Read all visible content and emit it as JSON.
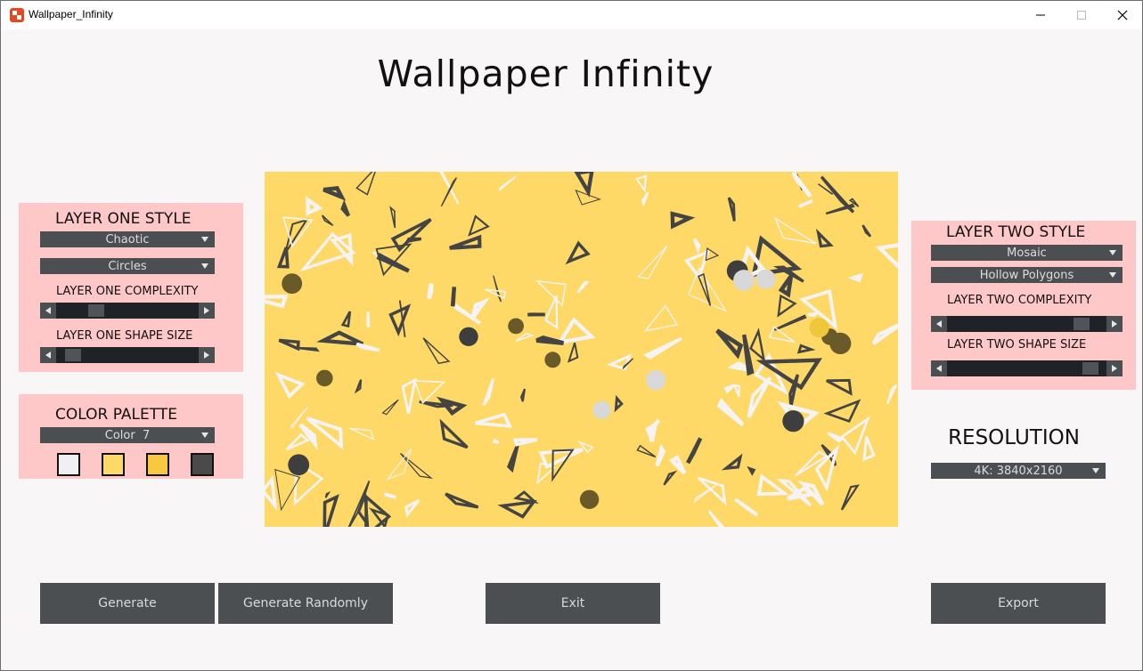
{
  "window": {
    "title": "Wallpaper_Infinity",
    "icon": "app-logo-icon"
  },
  "heading": "Wallpaper  Infinity",
  "layer_one": {
    "title": "LAYER ONE STYLE",
    "style": "Chaotic",
    "shape": "Circles",
    "complexity_label": "LAYER ONE COMPLEXITY",
    "complexity_value": 0.27,
    "size_label": "LAYER ONE SHAPE SIZE",
    "size_value": 0.08
  },
  "color_palette": {
    "title": "COLOR PALETTE",
    "selected": "Color  7",
    "swatches": [
      "#f0eff1",
      "#fed967",
      "#f9c840",
      "#4a4a4a"
    ]
  },
  "layer_two": {
    "title": "LAYER TWO STYLE",
    "style": "Mosaic",
    "shape": "Hollow Polygons",
    "complexity_label": "LAYER TWO COMPLEXITY",
    "complexity_value": 0.85,
    "size_label": "LAYER TWO SHAPE SIZE",
    "size_value": 0.92
  },
  "resolution": {
    "title": "RESOLUTION",
    "selected": "4K: 3840x2160"
  },
  "buttons": {
    "generate": "Generate",
    "generate_randomly": "Generate Randomly",
    "exit": "Exit",
    "export": "Export"
  },
  "colors": {
    "panel_bg": "#ffc8c8",
    "control_bg": "#4c4f52",
    "canvas_bg": "#fed967",
    "window_bg": "#f8f6f7"
  }
}
